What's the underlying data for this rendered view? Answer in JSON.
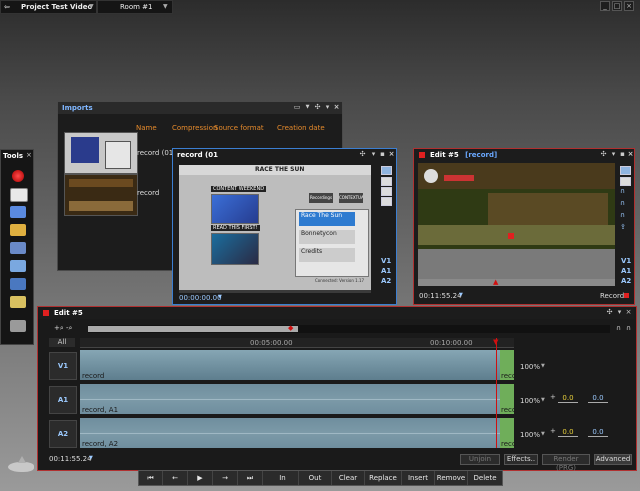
{
  "topbar": {
    "project_title": "Project Test Video",
    "project_dropdown_icon": "chevron-down-icon",
    "room": "Room #1",
    "room_dropdown_icon": "chevron-down-icon",
    "minimize": "_",
    "maximize": "□",
    "close": "×"
  },
  "imports": {
    "title": "Imports",
    "columns": [
      "Name",
      "Compression",
      "Source format",
      "Creation date"
    ],
    "rows": [
      {
        "name": "record (01"
      },
      {
        "name": "record"
      }
    ]
  },
  "record_panel": {
    "title": "record (01",
    "timecode": "00:00:00.00",
    "tracks": [
      "V1",
      "A1",
      "A2"
    ],
    "video": {
      "header": "RACE THE SUN",
      "menu_left": [
        "CONTENT WEEKEND",
        "READ THIS FIRST!"
      ],
      "buttons": [
        "Recordings",
        "CONTEXTUALIZE"
      ],
      "items": [
        "Race The Sun",
        "Bonnetycon",
        "Credits"
      ],
      "footer": "Connected: Version 1.17"
    }
  },
  "edit_panel": {
    "title": "Edit #5",
    "subtitle": "[record]",
    "timecode": "00:11:55.24",
    "record_label": "Record",
    "tracks": [
      "V1",
      "A1",
      "A2"
    ]
  },
  "tools": {
    "title": "Tools",
    "pin": "×",
    "items": [
      "record-icon",
      "capture-icon",
      "storyboard-icon",
      "folder-icon",
      "grid-icon",
      "3d-box-icon",
      "network-icon",
      "export-icon",
      "robot-icon"
    ]
  },
  "timeline": {
    "title": "Edit #5",
    "zoom_label": "All",
    "ruler": [
      "00:05:00.00",
      "00:10:00.00"
    ],
    "tracks": [
      {
        "name": "V1",
        "clip_label": "record",
        "clip_label2": "reco",
        "volume": "100%"
      },
      {
        "name": "A1",
        "clip_label": "record, A1",
        "clip_label2": "reco",
        "volume": "100%",
        "gain": "0.0",
        "gain2": "0.0"
      },
      {
        "name": "A2",
        "clip_label": "record, A2",
        "clip_label2": "reco",
        "volume": "100%",
        "gain": "0.0",
        "gain2": "0.0"
      }
    ],
    "timecode": "00:11:55.24",
    "buttons": [
      "Unjoin",
      "Effects..",
      "Render (PRG)",
      "Advanced"
    ]
  },
  "transport": {
    "nav": [
      "⏮",
      "←",
      "▶",
      "→",
      "⏭"
    ],
    "buttons": [
      "In",
      "Out",
      "Clear",
      "Replace",
      "Insert",
      "Remove",
      "Delete"
    ]
  },
  "colors": {
    "accent": "#3b7ed1",
    "edit_border": "#b03030",
    "playhead": "#d01010"
  }
}
